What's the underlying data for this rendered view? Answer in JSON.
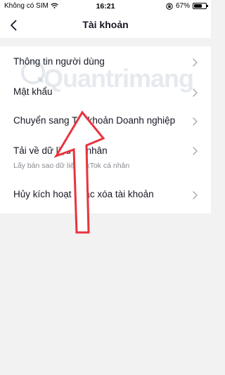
{
  "status_bar": {
    "carrier": "Không có SIM",
    "time": "16:21",
    "battery": "67%",
    "battery_level": 0.67,
    "icons": [
      "wifi-icon",
      "lock-rotation-icon",
      "battery-icon"
    ]
  },
  "nav": {
    "title": "Tài khoản",
    "back_icon": "chevron-left-icon"
  },
  "menu": {
    "items": [
      {
        "label": "Thông tin người dùng"
      },
      {
        "label": "Mật khẩu"
      },
      {
        "label": "Chuyển sang Tài khoản Doanh nghiệp"
      },
      {
        "label": "Tải về dữ liệu cá nhân",
        "sublabel": "Lấy bản sao dữ liệu TikTok cá nhân"
      },
      {
        "label": "Hủy kích hoạt hoặc xóa tài khoản"
      }
    ]
  },
  "watermark": {
    "text": "Quantrimang"
  },
  "colors": {
    "background": "#f2f2f2",
    "card": "#ffffff",
    "text": "#161823",
    "subtext": "#8a8b91",
    "chevron": "#a8a9ad",
    "annotation_arrow": "#e8333f"
  }
}
